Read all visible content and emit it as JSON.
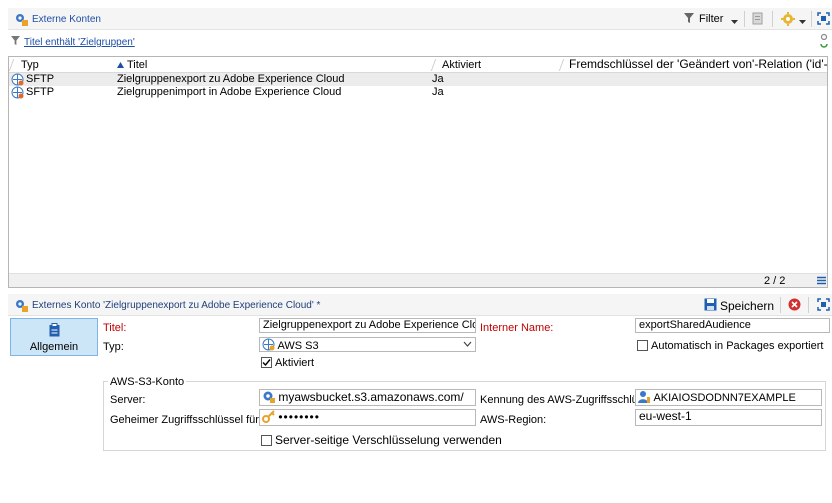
{
  "top_toolbar": {
    "title": "Externe Konten",
    "filter_label": "Filter",
    "filter_caption": "Titel enthält 'Zielgruppen'"
  },
  "list": {
    "columns": [
      "Typ",
      "Titel",
      "Aktiviert",
      "Fremdschlüssel der 'Geändert von'-Relation ('id'-"
    ],
    "rows": [
      {
        "type": "SFTP",
        "title": "Zielgruppenexport zu Adobe Experience Cloud",
        "active": "Ja"
      },
      {
        "type": "SFTP",
        "title": "Zielgruppenimport in Adobe Experience Cloud",
        "active": "Ja"
      }
    ],
    "pager": "2 / 2"
  },
  "detail": {
    "title": "Externes Konto 'Zielgruppenexport zu Adobe Experience Cloud' *",
    "save_label": "Speichern",
    "tab_label": "Allgemein",
    "titel_label": "Titel:",
    "titel_value": "Zielgruppenexport zu Adobe Experience Cloud",
    "internal_name_label": "Interner Name:",
    "internal_name_value": "exportSharedAudience",
    "typ_label": "Typ:",
    "typ_value": "AWS S3",
    "auto_packages_label": "Automatisch in Packages exportiert",
    "active_label": "Aktiviert",
    "group_title": "AWS-S3-Konto",
    "server_label": "Server:",
    "server_value": "myawsbucket.s3.amazonaws.com/",
    "aws_id_label": "Kennung des AWS-Zugriffsschlüssels:",
    "aws_id_value": "AKIAIOSDODNN7EXAMPLE",
    "secret_label": "Geheimer Zugriffsschlüssel für AWS:",
    "secret_value": "••••••••",
    "region_label": "AWS-Region:",
    "region_value": "eu-west-1",
    "sse_label": "Server-seitige Verschlüsselung verwenden"
  },
  "colors": {
    "link": "#1f4ea8",
    "required_label": "#c00000",
    "selected_tab": "#cde6f7",
    "save_icon": "#1f5fb0",
    "delete_icon": "#d03030"
  }
}
